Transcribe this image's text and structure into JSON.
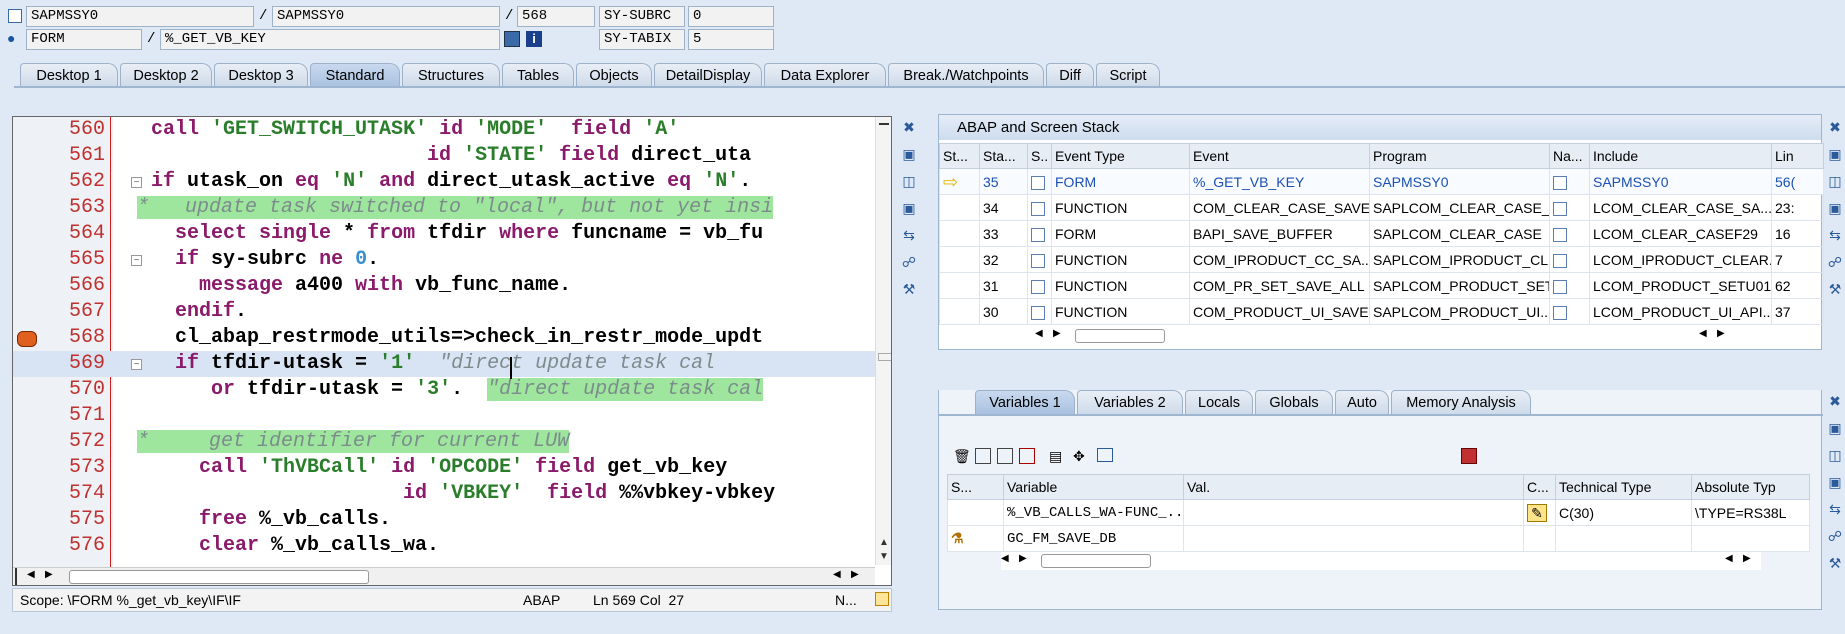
{
  "header": {
    "row1": {
      "program": "SAPMSSY0",
      "include": "SAPMSSY0",
      "line": "568",
      "sysfield_label": "SY-SUBRC",
      "sysfield_value": "0"
    },
    "row2": {
      "event_type": "FORM",
      "event": "%_GET_VB_KEY",
      "sysfield_label": "SY-TABIX",
      "sysfield_value": "5"
    },
    "separator": "/"
  },
  "tabs": [
    "Desktop 1",
    "Desktop 2",
    "Desktop 3",
    "Standard",
    "Structures",
    "Tables",
    "Objects",
    "DetailDisplay",
    "Data Explorer",
    "Break./Watchpoints",
    "Diff",
    "Script"
  ],
  "active_tab": "Standard",
  "editor": {
    "lines": [
      {
        "n": "560",
        "html": "<span class=\"kw\">call</span> <span class=\"str\">'GET_SWITCH_UTASK'</span> <span class=\"kw\">id</span> <span class=\"str\">'MODE'</span>  <span class=\"kw\">field</span> <span class=\"str\">'A'</span>"
      },
      {
        "n": "561",
        "html": "                       <span class=\"kw\">id</span> <span class=\"str\">'STATE'</span> <span class=\"kw\">field</span> direct_uta"
      },
      {
        "n": "562",
        "html": "<span class=\"kw\">if</span> utask_on <span class=\"kw\">eq</span> <span class=\"str\">'N'</span> <span class=\"kw\">and</span> direct_utask_active <span class=\"kw\">eq</span> <span class=\"str\">'N'</span>."
      },
      {
        "n": "563",
        "html": ""
      },
      {
        "n": "564",
        "html": "  <span class=\"kw\">select single</span> * <span class=\"kw\">from</span> tfdir <span class=\"kw\">where</span> funcname = vb_fu"
      },
      {
        "n": "565",
        "html": "  <span class=\"kw\">if</span> sy-subrc <span class=\"kw\">ne</span> <span class=\"num\">0</span>."
      },
      {
        "n": "566",
        "html": "    <span class=\"kw\">message</span> a400 <span class=\"kw\">with</span> vb_func_name."
      },
      {
        "n": "567",
        "html": "  <span class=\"kw\">endif</span>."
      },
      {
        "n": "568",
        "html": "  cl_abap_restrmode_utils=>check_in_restr_mode_updt"
      },
      {
        "n": "569",
        "html": "  <span class=\"kw\">if</span> tfdir-utask = <span class=\"str\">'1'</span>  <span class=\"cmt\">\"direct update task cal</span>"
      },
      {
        "n": "570",
        "html": "     <span class=\"kw\">or</span> tfdir-utask = <span class=\"str\">'3'</span>.  <span class=\"cmt hl-cmt\">\"direct update task cal</span>"
      },
      {
        "n": "571",
        "html": ""
      },
      {
        "n": "572",
        "html": ""
      },
      {
        "n": "573",
        "html": "    <span class=\"kw\">call</span> <span class=\"str\">'ThVBCall'</span> <span class=\"kw\">id</span> <span class=\"str\">'OPCODE'</span> <span class=\"kw\">field</span> get_vb_key"
      },
      {
        "n": "574",
        "html": "                     <span class=\"kw\">id</span> <span class=\"str\">'VBKEY'</span>  <span class=\"kw\">field</span> %%vbkey-vbkey"
      },
      {
        "n": "575",
        "html": "    <span class=\"kw\">free</span> %_vb_calls."
      },
      {
        "n": "576",
        "html": "    <span class=\"kw\">clear</span> %_vb_calls_wa."
      }
    ],
    "comment_563": "*   update task switched to \"local\", but not yet insi",
    "comment_572": "*     get identifier for current LUW",
    "status": {
      "scope": "Scope: \\FORM %_get_vb_key\\IF\\IF",
      "lang": "ABAP",
      "pos": "Ln 569 Col  27",
      "mode": "N..."
    }
  },
  "stack": {
    "title": "ABAP and Screen Stack",
    "columns": [
      "St...",
      "Sta...",
      "S..",
      "Event Type",
      "Event",
      "Program",
      "Na...",
      "Include",
      "Lin"
    ],
    "rows": [
      {
        "level": "35",
        "type": "FORM",
        "event": "%_GET_VB_KEY",
        "program": "SAPMSSY0",
        "include": "SAPMSSY0",
        "line": "56("
      },
      {
        "level": "34",
        "type": "FUNCTION",
        "event": "COM_CLEAR_CASE_SAVE",
        "program": "SAPLCOM_CLEAR_CASE_...",
        "include": "LCOM_CLEAR_CASE_SA...",
        "line": "23:"
      },
      {
        "level": "33",
        "type": "FORM",
        "event": "BAPI_SAVE_BUFFER",
        "program": "SAPLCOM_CLEAR_CASE",
        "include": "LCOM_CLEAR_CASEF29",
        "line": "16"
      },
      {
        "level": "32",
        "type": "FUNCTION",
        "event": "COM_IPRODUCT_CC_SA...",
        "program": "SAPLCOM_IPRODUCT_CL...",
        "include": "LCOM_IPRODUCT_CLEAR...",
        "line": "7"
      },
      {
        "level": "31",
        "type": "FUNCTION",
        "event": "COM_PR_SET_SAVE_ALL",
        "program": "SAPLCOM_PRODUCT_SET",
        "include": "LCOM_PRODUCT_SETU01",
        "line": "62"
      },
      {
        "level": "30",
        "type": "FUNCTION",
        "event": "COM_PRODUCT_UI_SAVE",
        "program": "SAPLCOM_PRODUCT_UI...",
        "include": "LCOM_PRODUCT_UI_API...",
        "line": "37"
      }
    ]
  },
  "vartabs": [
    "Variables 1",
    "Variables 2",
    "Locals",
    "Globals",
    "Auto",
    "Memory Analysis"
  ],
  "vars": {
    "columns": [
      "S...",
      "Variable",
      "Val.",
      "C...",
      "Technical Type",
      "Absolute Typ"
    ],
    "rows": [
      {
        "name": "%_VB_CALLS_WA-FUNC_...",
        "value": "",
        "tech": "C(30)",
        "abs": "\\TYPE=RS38L"
      },
      {
        "name": "GC_FM_SAVE_DB",
        "value": "",
        "tech": "",
        "abs": ""
      }
    ]
  }
}
